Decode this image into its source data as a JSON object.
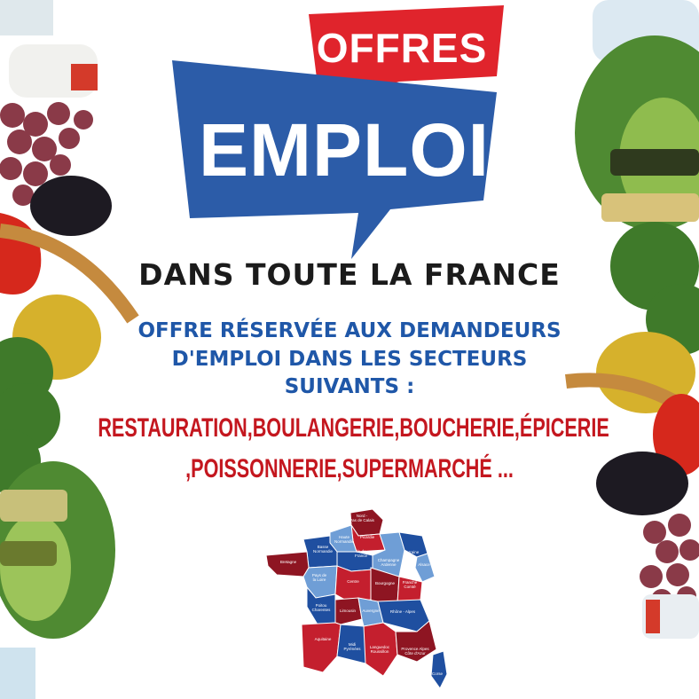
{
  "badge": {
    "offres": "OFFRES",
    "emploi": "EMPLOI",
    "red_color": "#e0242c",
    "blue_color": "#2c5ca8"
  },
  "headline": "DANS TOUTE LA FRANCE",
  "subheading": {
    "line1": "OFFRE RÉSERVÉE AUX DEMANDEURS",
    "line2": "D'EMPLOI  DANS LES SECTEURS",
    "line3": "SUIVANTS :"
  },
  "sectors": {
    "line1": "RESTAURATION,BOULANGERIE,BOUCHERIE,ÉPICERIE",
    "line2": ",POISSONNERIE,SUPERMARCHÉ ..."
  },
  "map": {
    "regions": [
      {
        "name": "Nord - Pas de Calais",
        "l1": "Nord -",
        "l2": "Pas de Calais",
        "color": "#8e1522"
      },
      {
        "name": "Picardie",
        "l1": "Picardie",
        "l2": "",
        "color": "#c41f2e"
      },
      {
        "name": "Haute Normandie",
        "l1": "Haute",
        "l2": "Normandie",
        "color": "#6f9ed6"
      },
      {
        "name": "Basse Normandie",
        "l1": "Basse",
        "l2": "Normandie",
        "color": "#1f4fa0"
      },
      {
        "name": "Bretagne",
        "l1": "Bretagne",
        "l2": "",
        "color": "#8e1522"
      },
      {
        "name": "Ile de France",
        "l1": "Ile de",
        "l2": "France",
        "color": "#1f4fa0"
      },
      {
        "name": "Champagne Ardenne",
        "l1": "Champagne",
        "l2": "Ardenne",
        "color": "#6f9ed6"
      },
      {
        "name": "Lorraine",
        "l1": "Lorraine",
        "l2": "",
        "color": "#1f4fa0"
      },
      {
        "name": "Alsace",
        "l1": "Alsace",
        "l2": "",
        "color": "#6f9ed6"
      },
      {
        "name": "Pays de la Loire",
        "l1": "Pays de",
        "l2": "la Loire",
        "color": "#6f9ed6"
      },
      {
        "name": "Centre",
        "l1": "Centre",
        "l2": "",
        "color": "#c41f2e"
      },
      {
        "name": "Bourgogne",
        "l1": "Bourgogne",
        "l2": "",
        "color": "#8e1522"
      },
      {
        "name": "Franche Comté",
        "l1": "Franche",
        "l2": "Comté",
        "color": "#c41f2e"
      },
      {
        "name": "Poitou Charentes",
        "l1": "Poitou",
        "l2": "Charentes",
        "color": "#1f4fa0"
      },
      {
        "name": "Limousin",
        "l1": "Limousin",
        "l2": "",
        "color": "#8e1522"
      },
      {
        "name": "Auvergne",
        "l1": "Auvergne",
        "l2": "",
        "color": "#6f9ed6"
      },
      {
        "name": "Rhône - Alpes",
        "l1": "Rhône - Alpes",
        "l2": "",
        "color": "#1f4fa0"
      },
      {
        "name": "Aquitaine",
        "l1": "Aquitaine",
        "l2": "",
        "color": "#c41f2e"
      },
      {
        "name": "Midi Pyrénées",
        "l1": "Midi",
        "l2": "Pyrénées",
        "color": "#1f4fa0"
      },
      {
        "name": "Languedoc Roussillon",
        "l1": "Languedoc",
        "l2": "Roussillon",
        "color": "#c41f2e"
      },
      {
        "name": "Provence Alpes Côte d'Azur",
        "l1": "Provence Alpes",
        "l2": "Côte d'Azur",
        "color": "#8e1522"
      },
      {
        "name": "Corse",
        "l1": "Corse",
        "l2": "",
        "color": "#1f4fa0"
      }
    ]
  }
}
